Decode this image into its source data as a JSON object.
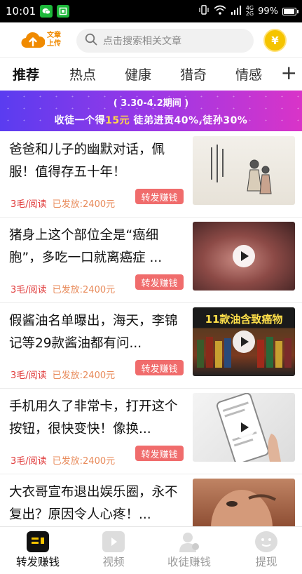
{
  "status_bar": {
    "time": "10:01",
    "network_label": "4G",
    "network_sub": "2G",
    "battery": "99%",
    "battery_level": 0.99
  },
  "header": {
    "logo_line1": "文章",
    "logo_line2": "上传",
    "search_placeholder": "点击搜索相关文章",
    "coin_symbol": "¥"
  },
  "tabs": [
    {
      "label": "推荐",
      "active": true
    },
    {
      "label": "热点",
      "active": false
    },
    {
      "label": "健康",
      "active": false
    },
    {
      "label": "猎奇",
      "active": false
    },
    {
      "label": "情感",
      "active": false
    }
  ],
  "tab_add": "+",
  "banner": {
    "line1": "( 3.30-4.2期间 )",
    "line2_a": "收徒一个得",
    "line2_hl": "15元",
    "line2_b": " 徒弟进贡40%,徒孙30%"
  },
  "articles": [
    {
      "title": "爸爸和儿子的幽默对话，佩服！值得存五十年！",
      "price": "3毛/阅读",
      "sent": "已发放:2400元",
      "action": "转发赚钱",
      "video": false
    },
    {
      "title": "猪身上这个部位全是“癌细胞”，多吃一口就离癌症 ...",
      "price": "3毛/阅读",
      "sent": "已发放:2400元",
      "action": "转发赚钱",
      "video": true
    },
    {
      "title": "假酱油名单曝出，海天，李锦记等29款酱油都有问...",
      "price": "3毛/阅读",
      "sent": "已发放:2400元",
      "action": "转发赚钱",
      "video": true,
      "thumb_text": "11款油含致癌物"
    },
    {
      "title": "手机用久了非常卡，打开这个按钮，很快变快！像换...",
      "price": "3毛/阅读",
      "sent": "已发放:2400元",
      "action": "转发赚钱",
      "video": true
    },
    {
      "title": "大衣哥宣布退出娱乐圈，永不复出？原因令人心疼！...",
      "price": "",
      "sent": "",
      "action": "",
      "video": false
    }
  ],
  "bottom_nav": [
    {
      "label": "转发赚钱",
      "icon": "share-money-icon",
      "active": true
    },
    {
      "label": "视频",
      "icon": "video-icon",
      "active": false
    },
    {
      "label": "收徒赚钱",
      "icon": "user-add-icon",
      "active": false
    },
    {
      "label": "提现",
      "icon": "withdraw-icon",
      "active": false
    }
  ],
  "colors": {
    "accent_orange": "#f08a00",
    "price_red": "#e03a3a",
    "button_red": "#f06c6c",
    "banner_start": "#5a3cf0",
    "banner_end": "#d934c8",
    "coin_yellow": "#f5c400"
  }
}
